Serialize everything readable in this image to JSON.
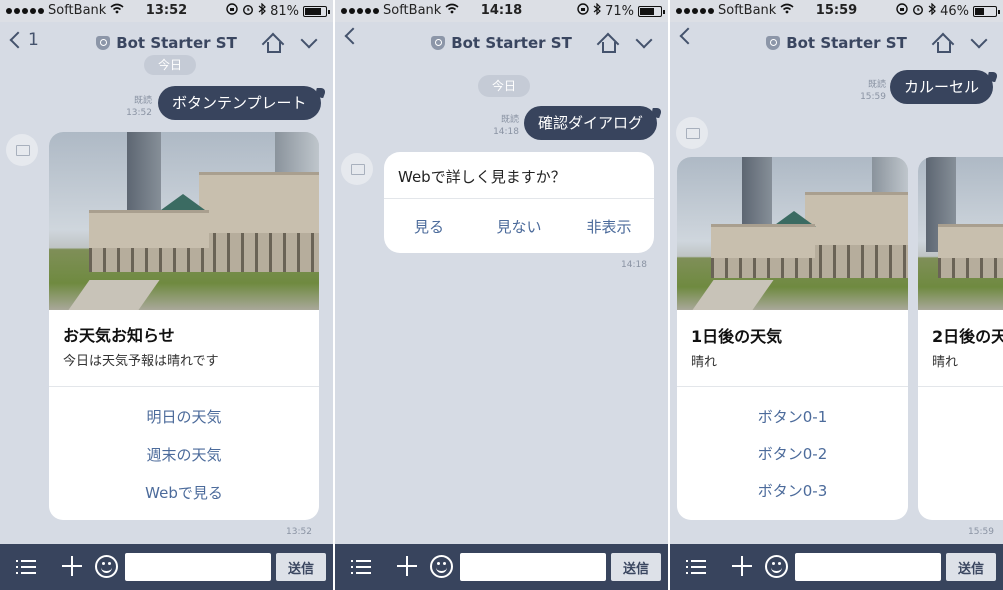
{
  "screens": [
    {
      "status": {
        "carrier": "SoftBank",
        "time": "13:52",
        "battery": "81%",
        "battery_level": 0.81
      },
      "header": {
        "back_count": "1",
        "title": "Bot Starter ST"
      },
      "date_pill": "今日",
      "sent": {
        "text": "ボタンテンプレート",
        "read": "既読",
        "time": "13:52"
      },
      "card": {
        "title": "お天気お知らせ",
        "text": "今日は天気予報は晴れです",
        "actions": [
          "明日の天気",
          "週末の天気",
          "Webで見る"
        ],
        "time": "13:52"
      },
      "input": {
        "placeholder": "",
        "send_label": "送信"
      }
    },
    {
      "status": {
        "carrier": "SoftBank",
        "time": "14:18",
        "battery": "71%",
        "battery_level": 0.71
      },
      "header": {
        "back_count": "",
        "title": "Bot Starter ST"
      },
      "date_pill": "今日",
      "sent": {
        "text": "確認ダイアログ",
        "read": "既読",
        "time": "14:18"
      },
      "confirm": {
        "question": "Webで詳しく見ますか？",
        "options": [
          "見る",
          "見ない",
          "非表示"
        ],
        "time": "14:18"
      },
      "input": {
        "placeholder": "",
        "send_label": "送信"
      }
    },
    {
      "status": {
        "carrier": "SoftBank",
        "time": "15:59",
        "battery": "46%",
        "battery_level": 0.46
      },
      "header": {
        "back_count": "",
        "title": "Bot Starter ST"
      },
      "sent": {
        "text": "カルーセル",
        "read": "既読",
        "time": "15:59"
      },
      "carousel": [
        {
          "title": "1日後の天気",
          "text": "晴れ",
          "actions": [
            "ボタン0-1",
            "ボタン0-2",
            "ボタン0-3"
          ]
        },
        {
          "title": "2日後の天",
          "text": "晴れ"
        }
      ],
      "time": "15:59",
      "input": {
        "placeholder": "",
        "send_label": "送信"
      }
    }
  ],
  "colors": {
    "navy": "#38445d",
    "chat_bg": "#d6dbe4",
    "link": "#4c6b9b"
  },
  "icons": [
    "signal-dots-icon",
    "wifi-icon",
    "lock-rotation-icon",
    "alarm-icon",
    "bluetooth-icon",
    "battery-icon",
    "back-chevron-icon",
    "shield-icon",
    "home-icon",
    "chevron-down-icon",
    "menu-icon",
    "plus-icon",
    "emoji-icon"
  ]
}
